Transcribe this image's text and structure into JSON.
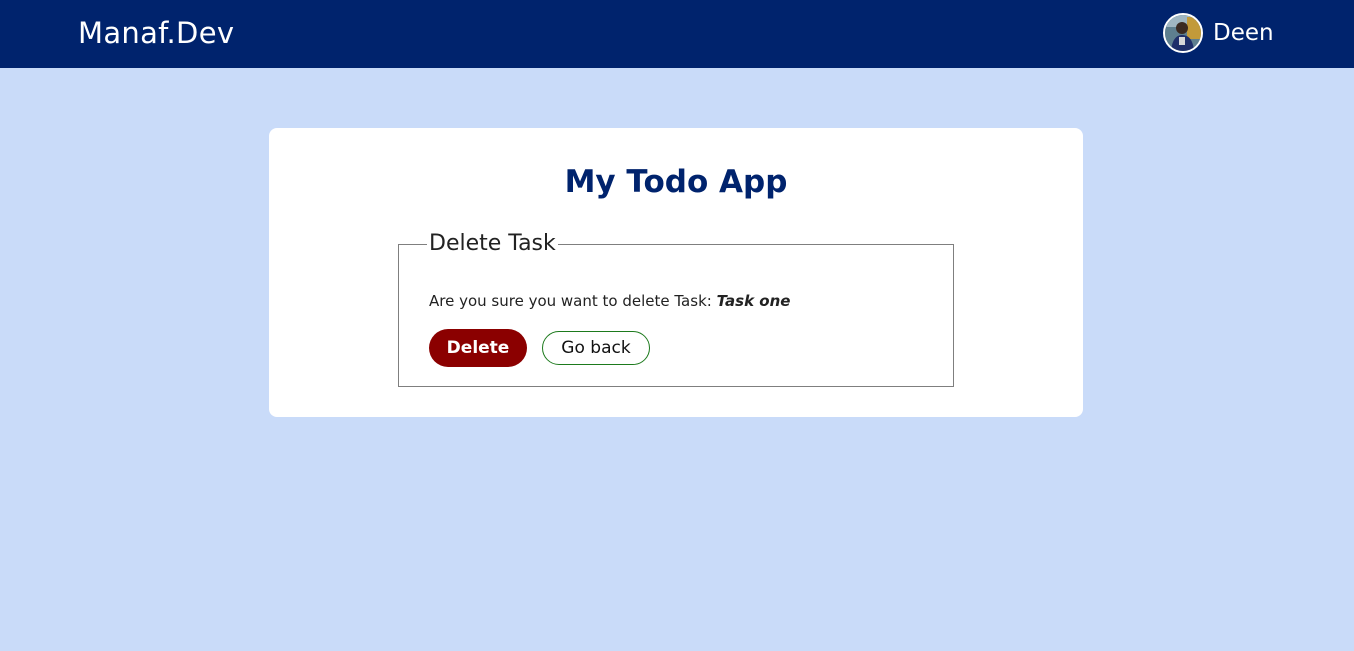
{
  "navbar": {
    "brand": "Manaf.Dev",
    "user": {
      "name": "Deen",
      "avatar_icon": "user-avatar"
    }
  },
  "card": {
    "title": "My Todo App",
    "fieldset": {
      "legend": "Delete Task",
      "confirm_prefix": "Are you sure you want to delete Task: ",
      "task_name": "Task one",
      "delete_label": "Delete",
      "back_label": "Go back"
    }
  },
  "colors": {
    "navbar_bg": "#00236d",
    "page_bg": "#c9dbf9",
    "title": "#00236d",
    "delete_bg": "#8b0000",
    "back_border": "#1d7a1d"
  }
}
